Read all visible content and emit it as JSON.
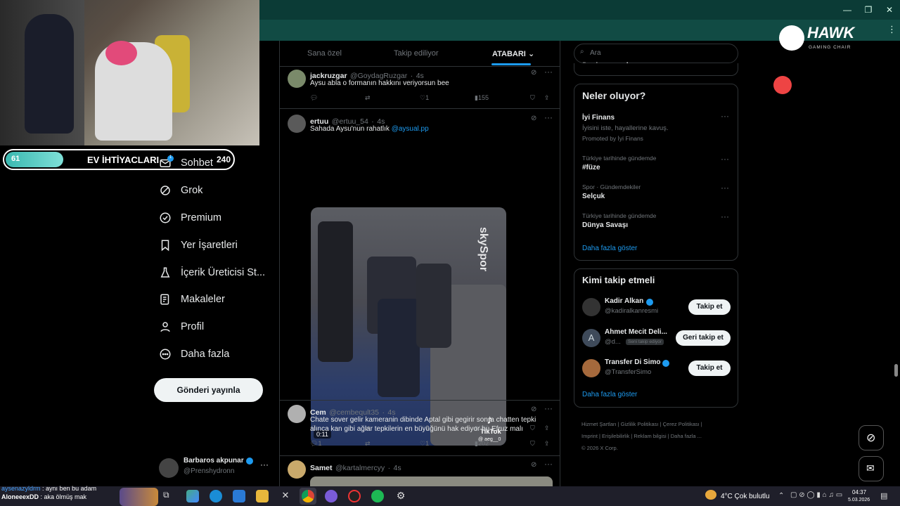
{
  "stream": {
    "needs_bar": {
      "left_value": "61",
      "title": "EV İHTİYACLARI",
      "right_value": "240",
      "fill_fraction": 0.25
    },
    "brand": {
      "name": "HAWK",
      "tagline": "GAMING CHAIR"
    }
  },
  "nav": {
    "items": [
      {
        "label": "Sohbet",
        "icon": "mail-icon",
        "badge": "1"
      },
      {
        "label": "Grok",
        "icon": "grok-icon"
      },
      {
        "label": "Premium",
        "icon": "premium-icon"
      },
      {
        "label": "Yer İşaretleri",
        "icon": "bookmark-icon"
      },
      {
        "label": "İçerik Üreticisi St...",
        "icon": "creator-icon"
      },
      {
        "label": "Makaleler",
        "icon": "articles-icon"
      },
      {
        "label": "Profil",
        "icon": "profile-icon"
      },
      {
        "label": "Daha fazla",
        "icon": "more-icon"
      }
    ],
    "post_button": "Gönderi yayınla",
    "profile": {
      "name": "Barbaros akpunar",
      "handle": "@Prenshydronn"
    }
  },
  "feed": {
    "tabs": [
      "Sana özel",
      "Takip ediliyor",
      "ATABARI"
    ],
    "tweets": [
      {
        "name": "jackruzgar",
        "handle": "@GoydagRuzgar",
        "time": "4s",
        "text": "Aysu abla o formanın hakkını veriyorsun bee",
        "replies": "",
        "retweets": "",
        "likes": "1",
        "views": "155"
      },
      {
        "name": "ertuu",
        "handle": "@ertuu_54",
        "time": "4s",
        "text": "Sahada Aysu'nun rahatlık ",
        "mention": "@aysual.pp",
        "video_duration": "0:11",
        "video_watermark": "TikTok",
        "video_user": "@ aeg__0",
        "video_brand": "skySpor",
        "replies": "",
        "retweets": "",
        "likes": "3",
        "views": "187"
      },
      {
        "name": "Cem",
        "handle": "@cembeqult35",
        "time": "4s",
        "text": "Chate sover gelir kameranin dibinde Aptal gibi gegirir sonra chatten tepki alınca kan gibi ağlar tepkilerin en büyüğünü hak ediyor bu Efruz malı",
        "replies": "1",
        "retweets": "",
        "likes": "1",
        "views": "202"
      },
      {
        "name": "Samet",
        "handle": "@kartalmercyy",
        "time": "4s",
        "text": ""
      }
    ]
  },
  "sidebar": {
    "search_placeholder": "Ara",
    "partial_text": "üzerine spaceho",
    "trends_title": "Neler oluyor?",
    "trends": [
      {
        "meta": "",
        "name": "İyi Finans",
        "sub": "İyisini iste, hayallerine kavuş.",
        "promo": "Promoted by İyi Finans"
      },
      {
        "meta": "Türkiye tarihinde gündemde",
        "name": "#füze"
      },
      {
        "meta": "Spor · Gündemdekiler",
        "name": "Selçuk"
      },
      {
        "meta": "Türkiye tarihinde gündemde",
        "name": "Dünya Savaşı"
      }
    ],
    "trends_more": "Daha fazla göster",
    "who_title": "Kimi takip etmeli",
    "who": [
      {
        "name": "Kadir Alkan",
        "handle": "@kadiralkanresmi",
        "button": "Takip et",
        "verified": true
      },
      {
        "name": "Ahmet Mecit Deli...",
        "handle": "@d...",
        "follows_you": "Seni takip ediyor",
        "button": "Geri takip et",
        "verified": false,
        "initial": "A"
      },
      {
        "name": "Transfer Di Simo",
        "handle": "@TransferSimo",
        "button": "Takip et",
        "verified": true
      }
    ],
    "who_more": "Daha fazla göster",
    "footer": [
      "Hizmet Şartları",
      "Gizlilik Politikası",
      "Çerez Politikası",
      "Imprint",
      "Erişilebilirlik",
      "Reklam bilgisi",
      "Daha fazla ...",
      "© 2026 X Corp."
    ]
  },
  "chat": [
    {
      "user": "aysenazyldrm",
      "text": ": aynı ben bu adam"
    },
    {
      "user": "AloneeexDD",
      "text": ": aka ölmüş mak"
    }
  ],
  "taskbar": {
    "weather": "4°C  Çok bulutlu",
    "time": "04:37",
    "date": "5.03.2026"
  }
}
